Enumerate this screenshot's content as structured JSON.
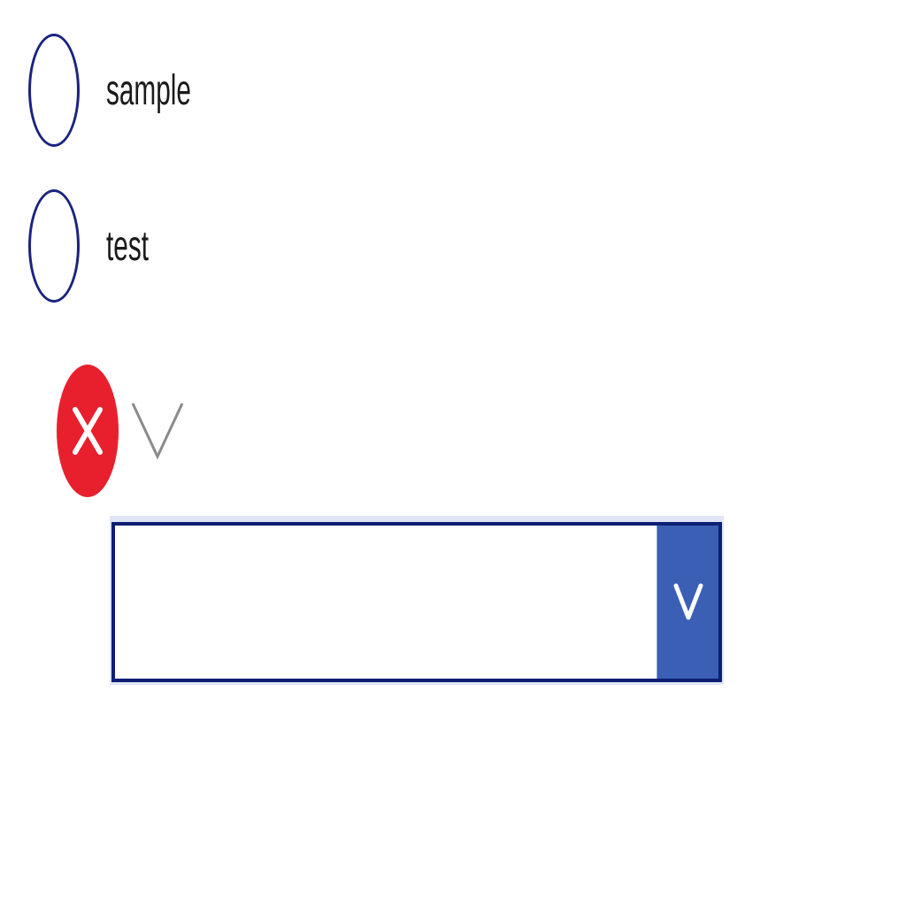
{
  "radio_group": {
    "options": [
      {
        "label": "sample",
        "selected": false
      },
      {
        "label": "test",
        "selected": false
      }
    ]
  },
  "validation": {
    "error_icon": "error-x-icon",
    "expand_icon": "chevron-down-icon",
    "error_color": "#e8202e"
  },
  "dropdown": {
    "value": "",
    "button_icon": "chevron-down-icon",
    "border_color": "#0d1f73",
    "button_color": "#3a5fb5"
  },
  "colors": {
    "radio_border": "#1a237e"
  }
}
